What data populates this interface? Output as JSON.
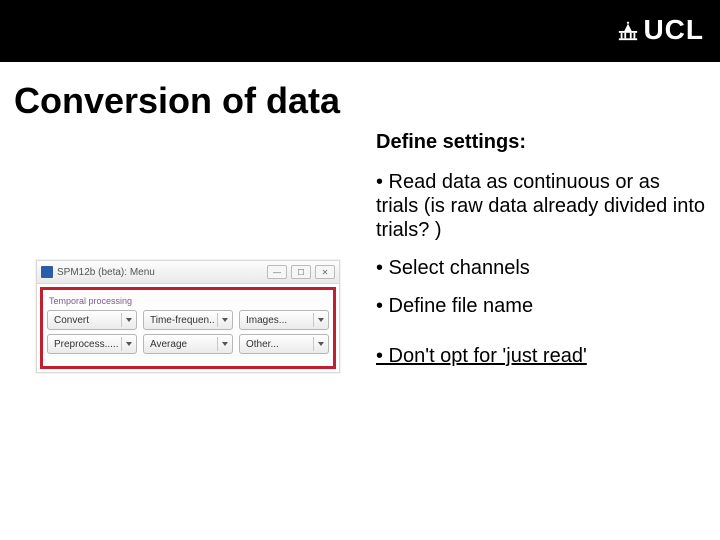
{
  "logo_text": "UCL",
  "title": "Conversion of data",
  "subheading": "Define settings:",
  "bullets": {
    "b1": "• Read data as continuous or as trials (is raw data already divided into trials? )",
    "b2": "• Select channels",
    "b3": "• Define file name",
    "b4": "• Don't opt for 'just read'"
  },
  "spm": {
    "window_title": "SPM12b (beta): Menu",
    "section_label": "Temporal processing",
    "row1": {
      "c1": "Convert",
      "c2": "Time-frequen..",
      "c3": "Images..."
    },
    "row2": {
      "c1": "Preprocess.....",
      "c2": "Average",
      "c3": "Other..."
    }
  }
}
